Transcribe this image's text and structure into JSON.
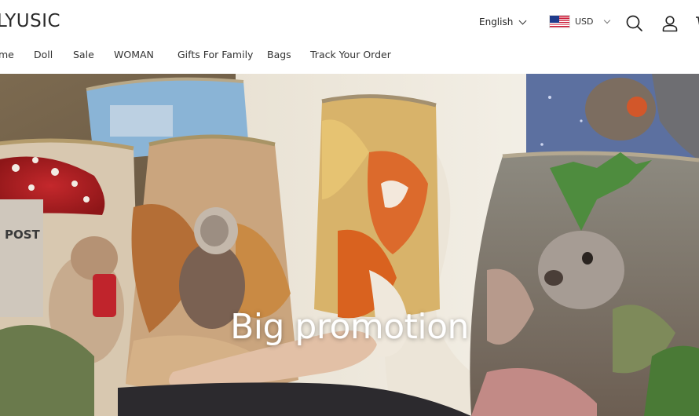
{
  "brand": {
    "logo_text": "LYUSIC"
  },
  "header": {
    "language": "English",
    "currency": "USD",
    "icons": [
      "search-icon",
      "account-icon",
      "cart-icon"
    ]
  },
  "nav": {
    "items": [
      {
        "label": "me"
      },
      {
        "label": "Doll"
      },
      {
        "label": "Sale"
      },
      {
        "label": "WOMAN"
      },
      {
        "label": "Gifts For Family"
      },
      {
        "label": "Bags"
      },
      {
        "label": "Track Your Order"
      }
    ]
  },
  "hero": {
    "title": "Big promotion"
  },
  "colors": {
    "text": "#222222",
    "hero_title": "#ffffff",
    "background": "#ffffff"
  }
}
